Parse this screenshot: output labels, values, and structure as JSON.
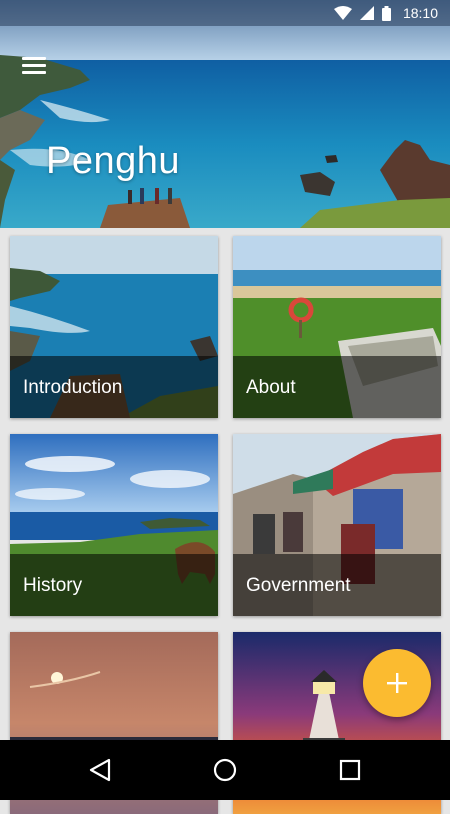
{
  "status_bar": {
    "time": "18:10",
    "icons": [
      "wifi-icon",
      "signal-icon",
      "battery-icon"
    ]
  },
  "header": {
    "title": "Penghu",
    "menu_icon": "hamburger-menu-icon"
  },
  "cards": [
    {
      "label": "Introduction",
      "image": "coastal-cliff-lookout"
    },
    {
      "label": "About",
      "image": "beach-with-boat"
    },
    {
      "label": "History",
      "image": "grassland-with-cow"
    },
    {
      "label": "Government",
      "image": "traditional-temple-house"
    },
    {
      "label": "",
      "image": "sunset-sky"
    },
    {
      "label": "",
      "image": "lighthouse-at-dusk"
    }
  ],
  "fab": {
    "icon": "plus-icon",
    "color": "#fbbb30"
  },
  "nav": {
    "icons": [
      "back-icon",
      "home-icon",
      "recents-icon"
    ]
  }
}
